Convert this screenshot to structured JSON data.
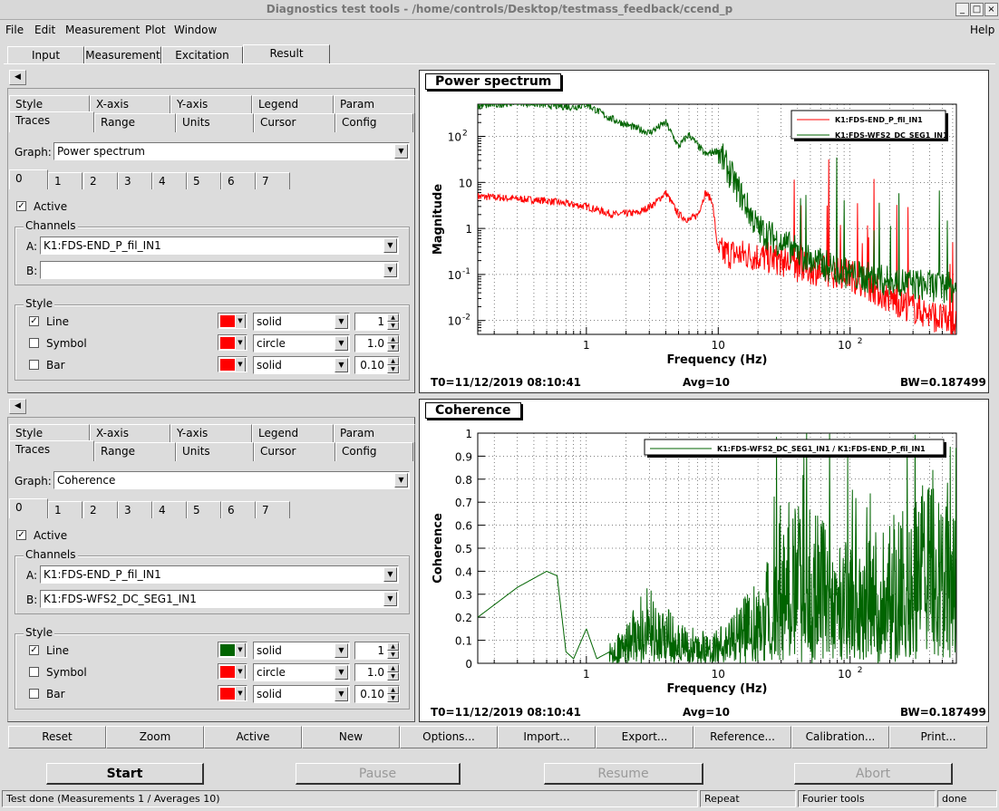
{
  "window": {
    "title": "Diagnostics test tools - /home/controls/Desktop/testmass_feedback/ccend_p"
  },
  "menu": [
    "File",
    "Edit",
    "Measurement",
    "Plot",
    "Window"
  ],
  "help": "Help",
  "main_tabs": [
    "Input",
    "Measurement",
    "Excitation",
    "Result"
  ],
  "panels": [
    {
      "tabs_row1": [
        "Style",
        "X-axis",
        "Y-axis",
        "Legend",
        "Param"
      ],
      "tabs_row2": [
        "Traces",
        "Range",
        "Units",
        "Cursor",
        "Config"
      ],
      "graph_label": "Graph:",
      "graph": "Power spectrum",
      "trace_tabs": [
        "0",
        "1",
        "2",
        "3",
        "4",
        "5",
        "6",
        "7"
      ],
      "active_label": "Active",
      "channels_label": "Channels",
      "a_label": "A:",
      "b_label": "B:",
      "channel_a": "K1:FDS-END_P_fil_IN1",
      "channel_b": "",
      "style_label": "Style",
      "line_label": "Line",
      "symbol_label": "Symbol",
      "bar_label": "Bar",
      "line_color": "#ff0000",
      "symbol_color": "#ff0000",
      "bar_color": "#ff0000",
      "line_style": "solid",
      "symbol_style": "circle",
      "bar_style": "solid",
      "line_width": "1",
      "symbol_size": "1.0",
      "bar_width": "0.10"
    },
    {
      "tabs_row1": [
        "Style",
        "X-axis",
        "Y-axis",
        "Legend",
        "Param"
      ],
      "tabs_row2": [
        "Traces",
        "Range",
        "Units",
        "Cursor",
        "Config"
      ],
      "graph_label": "Graph:",
      "graph": "Coherence",
      "trace_tabs": [
        "0",
        "1",
        "2",
        "3",
        "4",
        "5",
        "6",
        "7"
      ],
      "active_label": "Active",
      "channels_label": "Channels",
      "a_label": "A:",
      "b_label": "B:",
      "channel_a": "K1:FDS-END_P_fil_IN1",
      "channel_b": "K1:FDS-WFS2_DC_SEG1_IN1",
      "style_label": "Style",
      "line_label": "Line",
      "symbol_label": "Symbol",
      "bar_label": "Bar",
      "line_color": "#006400",
      "symbol_color": "#ff0000",
      "bar_color": "#ff0000",
      "line_style": "solid",
      "symbol_style": "circle",
      "bar_style": "solid",
      "line_width": "1",
      "symbol_size": "1.0",
      "bar_width": "0.10"
    }
  ],
  "plots": [
    {
      "title": "Power spectrum",
      "xlabel": "Frequency (Hz)",
      "ylabel": "Magnitude",
      "t0": "T0=11/12/2019 08:10:41",
      "avg": "Avg=10",
      "bw": "BW=0.187499",
      "legend": [
        "K1:FDS-END_P_fil_IN1",
        "K1:FDS-WFS2_DC_SEG1_IN1"
      ]
    },
    {
      "title": "Coherence",
      "xlabel": "Frequency (Hz)",
      "ylabel": "Coherence",
      "t0": "T0=11/12/2019 08:10:41",
      "avg": "Avg=10",
      "bw": "BW=0.187499",
      "legend": [
        "K1:FDS-WFS2_DC_SEG1_IN1 / K1:FDS-END_P_fil_IN1"
      ]
    }
  ],
  "chart_data": [
    {
      "type": "line",
      "title": "Power spectrum",
      "xlabel": "Frequency (Hz)",
      "ylabel": "Magnitude",
      "xscale": "log",
      "yscale": "log",
      "xlim": [
        0.15,
        640
      ],
      "ylim": [
        0.005,
        500
      ],
      "x_ticks": [
        "1",
        "10",
        "10^2"
      ],
      "y_ticks": [
        "10^-2",
        "10^-1",
        "1",
        "10",
        "10^2"
      ],
      "grid": true,
      "legend_position": "top-right",
      "series": [
        {
          "name": "K1:FDS-END_P_fil_IN1",
          "color": "#ff0000",
          "x": [
            0.15,
            0.5,
            1,
            1.6,
            2.5,
            3.3,
            4,
            5,
            6,
            7,
            8,
            9,
            10,
            20,
            30,
            40,
            60,
            100,
            200,
            640
          ],
          "y": [
            5,
            4,
            3,
            2,
            2.2,
            3.5,
            6,
            2,
            1.5,
            2,
            6,
            4,
            0.3,
            0.25,
            0.2,
            0.15,
            0.12,
            0.1,
            0.03,
            0.008
          ]
        },
        {
          "name": "K1:FDS-WFS2_DC_SEG1_IN1",
          "color": "#006400",
          "x": [
            0.15,
            0.3,
            0.5,
            0.8,
            1,
            1.5,
            2,
            3,
            4,
            5,
            6,
            8,
            10,
            20,
            30,
            50,
            70,
            100,
            200,
            640
          ],
          "y": [
            450,
            550,
            480,
            430,
            500,
            250,
            180,
            120,
            200,
            60,
            110,
            40,
            50,
            1,
            0.5,
            0.2,
            0.15,
            0.1,
            0.07,
            0.05
          ]
        }
      ]
    },
    {
      "type": "line",
      "title": "Coherence",
      "xlabel": "Frequency (Hz)",
      "ylabel": "Coherence",
      "xscale": "log",
      "xlim": [
        0.15,
        640
      ],
      "ylim": [
        0,
        1
      ],
      "x_ticks": [
        "1",
        "10",
        "10^2"
      ],
      "y_ticks": [
        "0",
        "0.1",
        "0.2",
        "0.3",
        "0.4",
        "0.5",
        "0.6",
        "0.7",
        "0.8",
        "0.9",
        "1"
      ],
      "grid": true,
      "legend_position": "top-right",
      "series": [
        {
          "name": "K1:FDS-WFS2_DC_SEG1_IN1 / K1:FDS-END_P_fil_IN1",
          "color": "#006400",
          "x": [
            0.15,
            0.3,
            0.5,
            0.6,
            0.7,
            0.8,
            1,
            1.2,
            1.5,
            2,
            3,
            5,
            10,
            20,
            30,
            50,
            100,
            200,
            640
          ],
          "y": [
            0.2,
            0.33,
            0.4,
            0.38,
            0.05,
            0.02,
            0.15,
            0.02,
            0.05,
            0.1,
            0.2,
            0.1,
            0.08,
            0.2,
            0.35,
            0.4,
            0.3,
            0.35,
            0.55
          ]
        }
      ]
    }
  ],
  "bottom_buttons": [
    "Reset",
    "Zoom",
    "Active",
    "New",
    "Options...",
    "Import...",
    "Export...",
    "Reference...",
    "Calibration...",
    "Print..."
  ],
  "control_buttons": [
    "Start",
    "Pause",
    "Resume",
    "Abort"
  ],
  "status": [
    "Test done (Measurements 1 / Averages 10)",
    "Repeat",
    "Fourier tools",
    "done"
  ]
}
